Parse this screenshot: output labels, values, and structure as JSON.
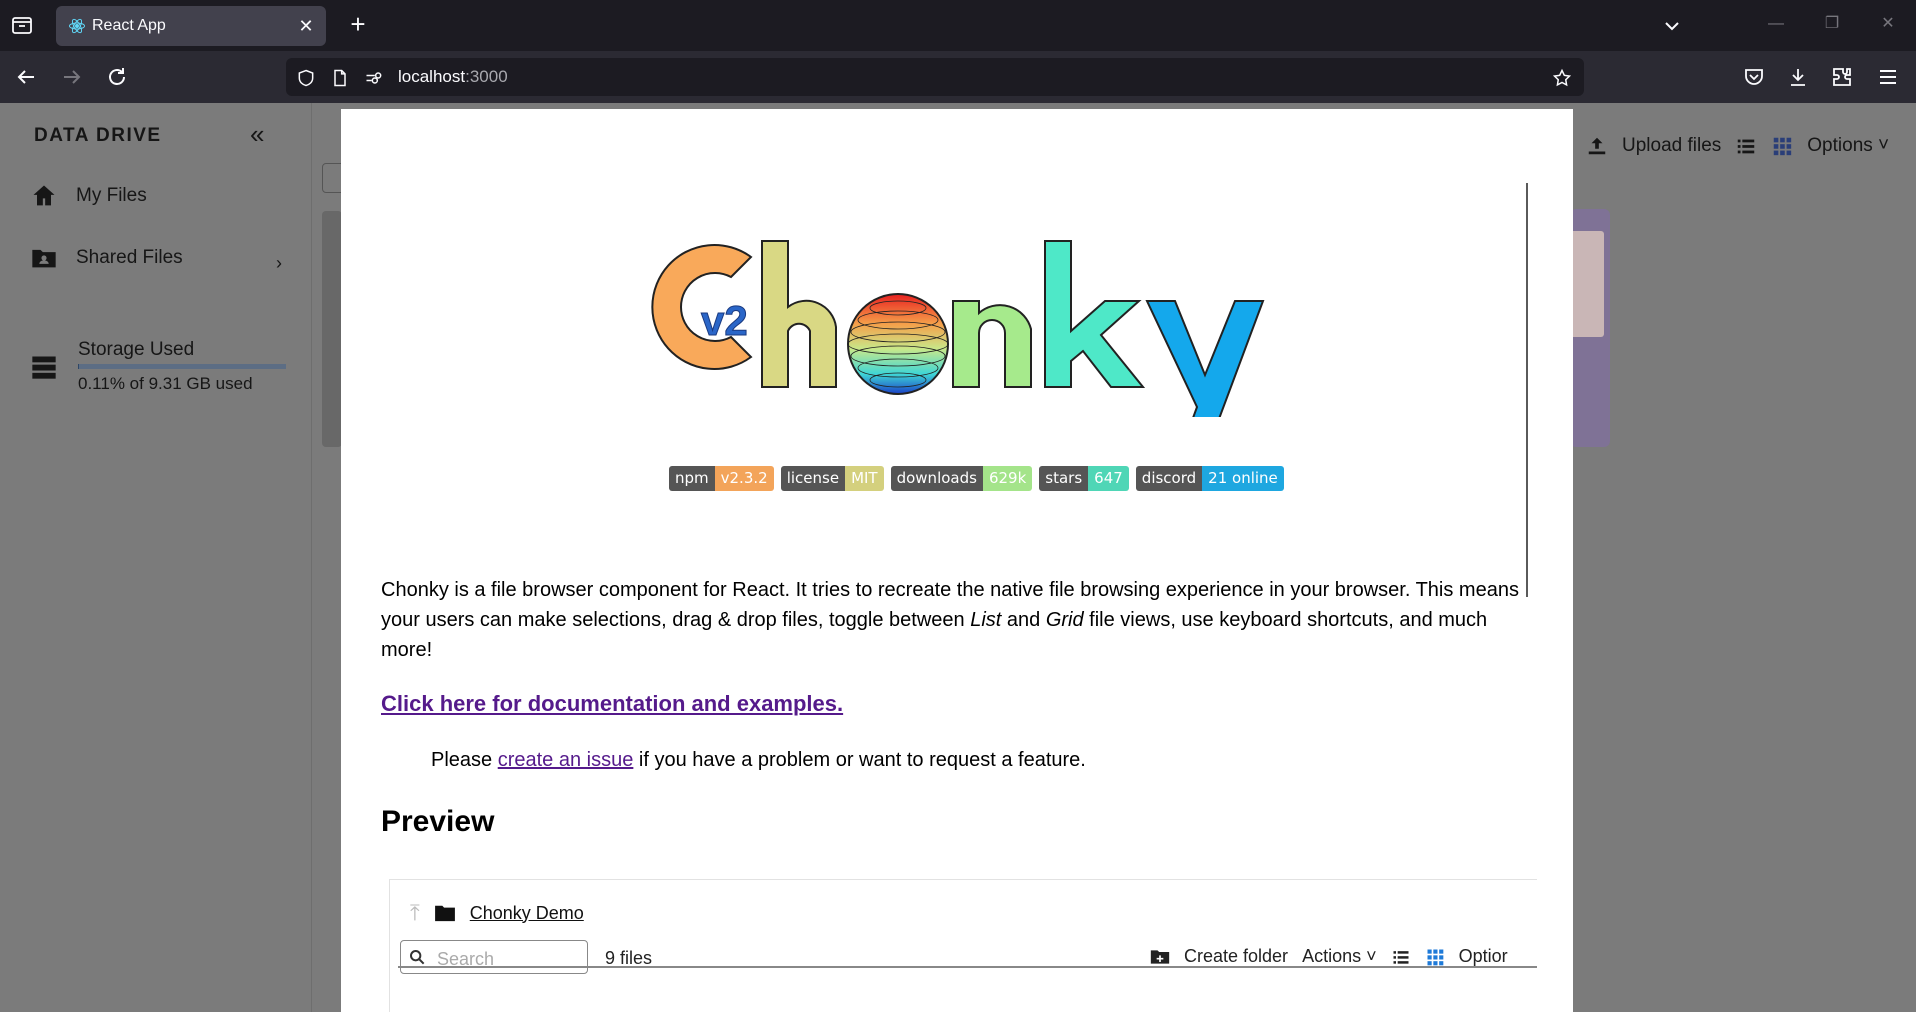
{
  "browser": {
    "tab_title": "React App",
    "url_host": "localhost",
    "url_port": ":3000",
    "icons": [
      "tab-list-icon",
      "react-favicon",
      "close-icon",
      "plus-icon",
      "chevron-down-icon",
      "minimize-icon",
      "restore-icon",
      "window-close-icon",
      "back-icon",
      "forward-icon",
      "reload-icon",
      "shield-icon",
      "page-icon",
      "permissions-icon",
      "star-icon",
      "pocket-icon",
      "download-icon",
      "extensions-icon",
      "menu-icon"
    ]
  },
  "sidebar": {
    "brand": "DATA DRIVE",
    "items": [
      {
        "label": "My Files",
        "icon": "home-icon"
      },
      {
        "label": "Shared Files",
        "icon": "shared-folder-icon"
      }
    ],
    "storage": {
      "title": "Storage Used",
      "text": "0.11% of 9.31 GB used",
      "fraction": 0.0011
    }
  },
  "main": {
    "upload_label": "Upload files",
    "options_label": "Options"
  },
  "modal": {
    "logo_text": "Chonky",
    "logo_badge": "v2",
    "badges": [
      {
        "label": "npm",
        "value": "v2.3.2",
        "color": "#f3a45a"
      },
      {
        "label": "license",
        "value": "MIT",
        "color": "#d4d07e"
      },
      {
        "label": "downloads",
        "value": "629k",
        "color": "#a4e48a"
      },
      {
        "label": "stars",
        "value": "647",
        "color": "#4fd6b6"
      },
      {
        "label": "discord",
        "value": "21 online",
        "color": "#1ea7e0"
      }
    ],
    "para_part1": "Chonky is a file browser component for React. It tries to recreate the native file browsing experience in your browser. This means your users can make selections, drag & drop files, toggle between ",
    "para_list": "List",
    "para_and": " and ",
    "para_grid": "Grid",
    "para_part2": " file views, use keyboard shortcuts, and much more!",
    "doc_link": "Click here for documentation and examples.",
    "issue_pre": "Please ",
    "issue_link": "create an issue",
    "issue_post": " if you have a problem or want to request a feature.",
    "preview_heading": "Preview",
    "demo": {
      "folder_name": "Chonky Demo",
      "search_placeholder": "Search",
      "file_count": "9 files",
      "create_folder": "Create folder",
      "actions": "Actions",
      "options": "Optior"
    }
  }
}
